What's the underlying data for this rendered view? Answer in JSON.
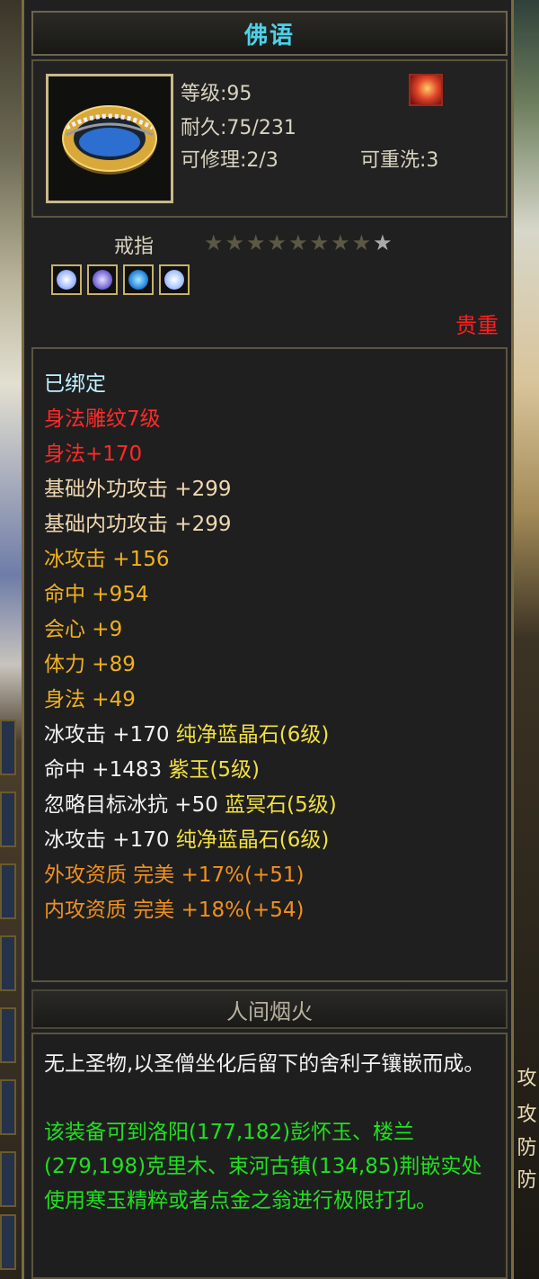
{
  "tooltip": {
    "title": "佛语",
    "header": {
      "level": "等级:95",
      "durability": "耐久:75/231",
      "repairable": "可修理:2/3",
      "rewashable": "可重洗:3"
    },
    "item_type": "戒指",
    "stars": {
      "filled": 9,
      "total": 9
    },
    "gems": [
      "gem-slot-1",
      "gem-slot-2",
      "gem-slot-3",
      "gem-slot-4"
    ],
    "quality": "贵重",
    "attributes": [
      {
        "text": "已绑定",
        "color": "#bff0ff"
      },
      {
        "text": "身法雕纹7级",
        "color": "#ff2a2a"
      },
      {
        "text": "身法+170",
        "color": "#ff2a2a"
      },
      {
        "text": "基础外功攻击 +299",
        "color": "#f0d8b0"
      },
      {
        "text": "基础内功攻击 +299",
        "color": "#f0d8b0"
      },
      {
        "text": "冰攻击 +156",
        "color": "#f0b020"
      },
      {
        "text": "命中 +954",
        "color": "#f0b020"
      },
      {
        "text": "会心 +9",
        "color": "#f0b020"
      },
      {
        "text": "体力 +89",
        "color": "#f0b020"
      },
      {
        "text": "身法 +49",
        "color": "#f0b020"
      },
      {
        "text": "冰攻击 +170 纯净蓝晶石(6级)",
        "color": "#f2f2f2",
        "suffix_color": "#f0e040"
      },
      {
        "text": "命中 +1483 紫玉(5级)",
        "color": "#f2f2f2",
        "suffix_color": "#f0e040"
      },
      {
        "text": "忽略目标冰抗 +50 蓝冥石(5级)",
        "color": "#f2f2f2",
        "suffix_color": "#f0e040"
      },
      {
        "text": "冰攻击 +170 纯净蓝晶石(6级)",
        "color": "#f2f2f2",
        "suffix_color": "#f0e040"
      },
      {
        "text": "外攻资质  完美 +17%(+51)",
        "color": "#f09020"
      },
      {
        "text": "内攻资质  完美 +18%(+54)",
        "color": "#f09020"
      }
    ],
    "set_name": "人间烟火",
    "description": {
      "lore": "无上圣物,以圣僧坐化后留下的舍利子镶嵌而成。",
      "hint": "该装备可到洛阳(177,182)彭怀玉、楼兰(279,198)克里木、束河古镇(134,85)荆嵌实处使用寒玉精粹或者点金之翁进行极限打孔。"
    }
  },
  "side": {
    "right_labels": [
      "攻",
      "攻",
      "防",
      "防"
    ]
  }
}
